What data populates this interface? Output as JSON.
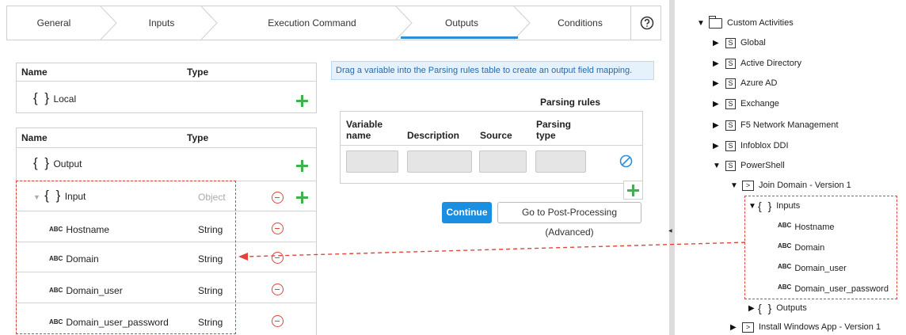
{
  "wizard": {
    "steps": [
      "General",
      "Inputs",
      "Execution Command",
      "Outputs",
      "Conditions"
    ],
    "active": "Outputs",
    "help_icon": "question-circle-icon"
  },
  "local_table": {
    "col_name": "Name",
    "col_type": "Type",
    "row_label": "Local"
  },
  "output_table": {
    "col_name": "Name",
    "col_type": "Type",
    "output_label": "Output",
    "input_label": "Input",
    "input_type": "Object",
    "fields": [
      {
        "name": "Hostname",
        "type": "String"
      },
      {
        "name": "Domain",
        "type": "String"
      },
      {
        "name": "Domain_user",
        "type": "String"
      },
      {
        "name": "Domain_user_password",
        "type": "String"
      }
    ],
    "abc_badge": "ABC"
  },
  "info_text": "Drag a variable into the Parsing rules table to create an output field mapping.",
  "parsing": {
    "title": "Parsing rules",
    "columns": [
      "Variable name",
      "Description",
      "Source",
      "Parsing type"
    ],
    "col_variable_line1": "Variable",
    "col_variable_line2": "name",
    "col_parsing_line1": "Parsing",
    "col_parsing_line2": "type"
  },
  "buttons": {
    "continue": "Continue",
    "post_processing": "Go to Post-Processing (Advanced)"
  },
  "tree": {
    "root": "Custom Activities",
    "items": [
      "Global",
      "Active Directory",
      "Azure AD",
      "Exchange",
      "F5 Network Management",
      "Infoblox DDI",
      "PowerShell"
    ],
    "s_badge": "S",
    "activity": "Join Domain - Version 1",
    "inputs_label": "Inputs",
    "input_fields": [
      "Hostname",
      "Domain",
      "Domain_user",
      "Domain_user_password"
    ],
    "outputs_label": "Outputs",
    "next_activity": "Install Windows App - Version 1",
    "abc_badge": "ABC",
    "prompt_badge": ">"
  },
  "colors": {
    "accent": "#1a8ee0",
    "add": "#3fb24f",
    "remove": "#e0443d",
    "highlight_dash": "#e0443d"
  }
}
